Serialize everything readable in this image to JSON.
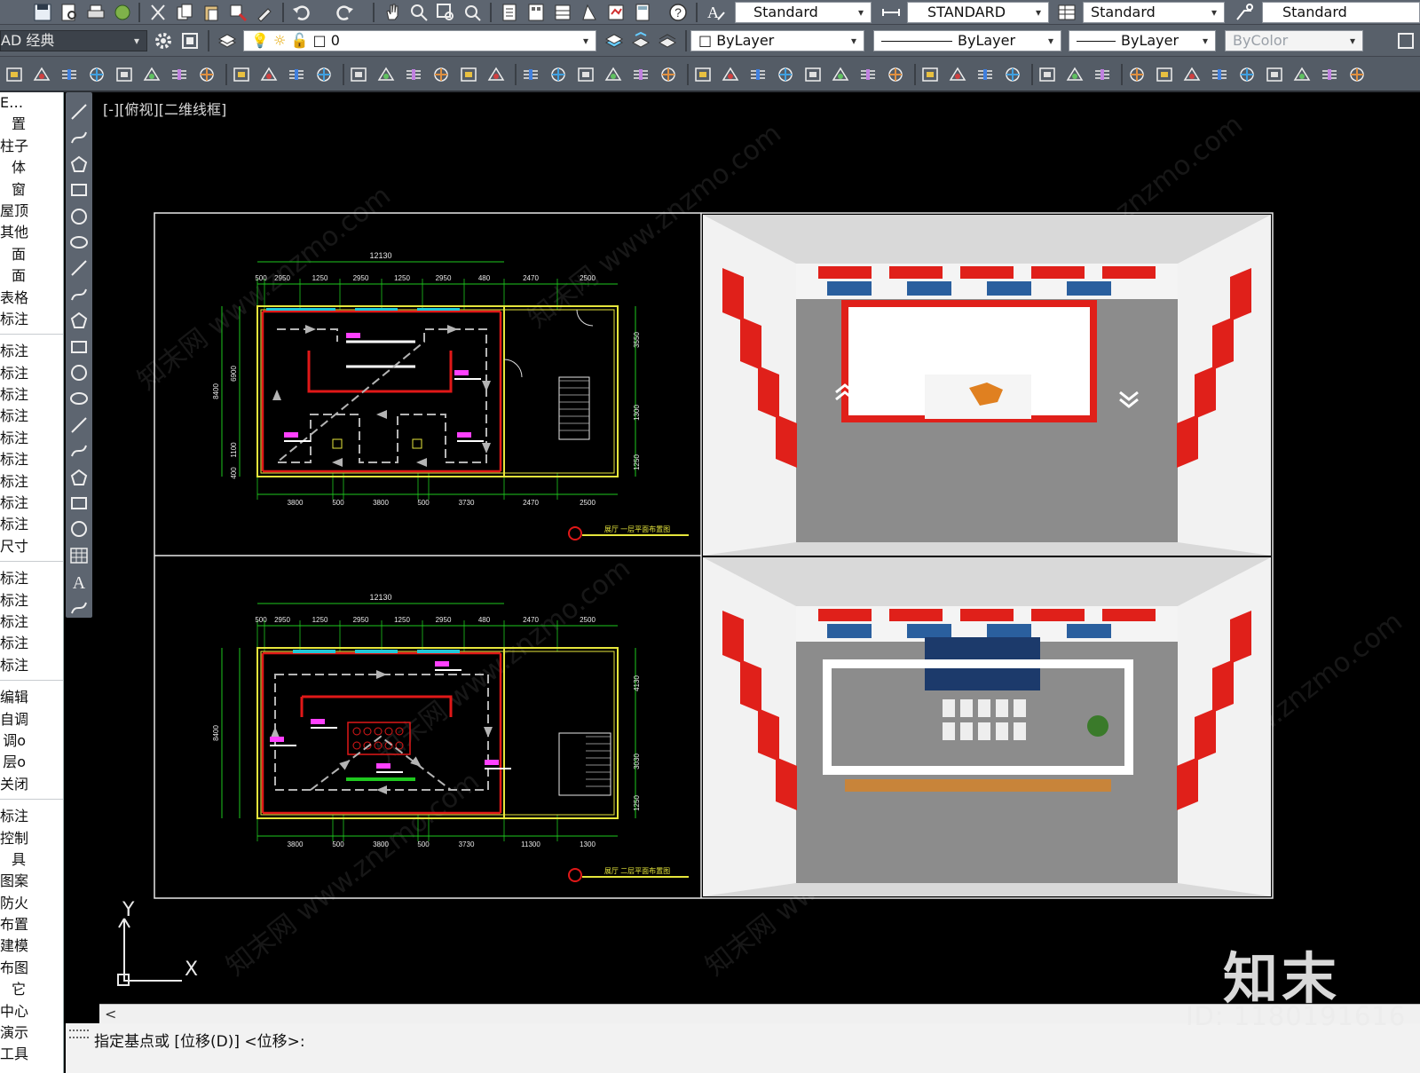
{
  "toolbar1": {
    "text_style": "Standard",
    "dim_style": "STANDARD",
    "table_style": "Standard",
    "mleader_style": "Standard"
  },
  "toolbar2": {
    "workspace": "AD 经典",
    "layer": "0",
    "color": "ByLayer",
    "linetype": "ByLayer",
    "lineweight": "ByLayer",
    "plotstyle": "ByColor"
  },
  "left_palette": {
    "items": [
      "E…",
      "置",
      "柱子",
      "体",
      "窗",
      "屋顶",
      "其他",
      "面",
      "面",
      "表格",
      "标注",
      "",
      "标注",
      "标注",
      "标注",
      "标注",
      "标注",
      "标注",
      "标注",
      "标注",
      "标注",
      "尺寸",
      "",
      "标注",
      "标注",
      "标注",
      "标注",
      "标注",
      "",
      "编辑",
      "自调",
      "调o",
      "层o",
      "关闭",
      "",
      "标注",
      "控制",
      "具",
      "图案",
      "防火",
      "布置",
      "建模",
      "布图",
      "它",
      "中心",
      "演示",
      "工具"
    ]
  },
  "viewport": {
    "label": "[-][俯视][二维线框]"
  },
  "plan_top": {
    "overall_width": "12130",
    "top_dims": [
      "500",
      "2950",
      "1250",
      "2950",
      "1250",
      "2950",
      "480",
      "2470",
      "2500"
    ],
    "bottom_dims": [
      "3800",
      "500",
      "3800",
      "500",
      "3730",
      "2470",
      "2500"
    ],
    "left_dims": [
      "8400",
      "6900",
      "1100",
      "400"
    ],
    "right_dims": [
      "3550",
      "1300",
      "1250"
    ],
    "title": "展厅 一层平面布置图"
  },
  "plan_bottom": {
    "overall_width": "12130",
    "top_dims": [
      "500",
      "2950",
      "1250",
      "2950",
      "1250",
      "2950",
      "480",
      "2470",
      "2500"
    ],
    "bottom_dims": [
      "3800",
      "500",
      "3800",
      "500",
      "3730",
      "11300",
      "1300"
    ],
    "left_dims": [
      "8400"
    ],
    "right_dims": [
      "4130",
      "3030",
      "1250"
    ],
    "title": "展厅 二层平面布置图"
  },
  "command": {
    "prompt": "指定基点或 [位移(D)] <位移>:"
  },
  "ucs": {
    "x": "X",
    "y": "Y"
  },
  "watermark": {
    "brand": "知末",
    "id": "ID: 1180191616",
    "diag": "知末网 www.znzmo.com"
  },
  "colors": {
    "toolbar": "#5d6570",
    "cad_red": "#e01818",
    "cad_yellow": "#e6e63c",
    "cad_green": "#1ec81e",
    "cad_magenta": "#ff40ff",
    "cad_cyan": "#20c8d8",
    "arrow_gray": "#b4b4b4"
  }
}
